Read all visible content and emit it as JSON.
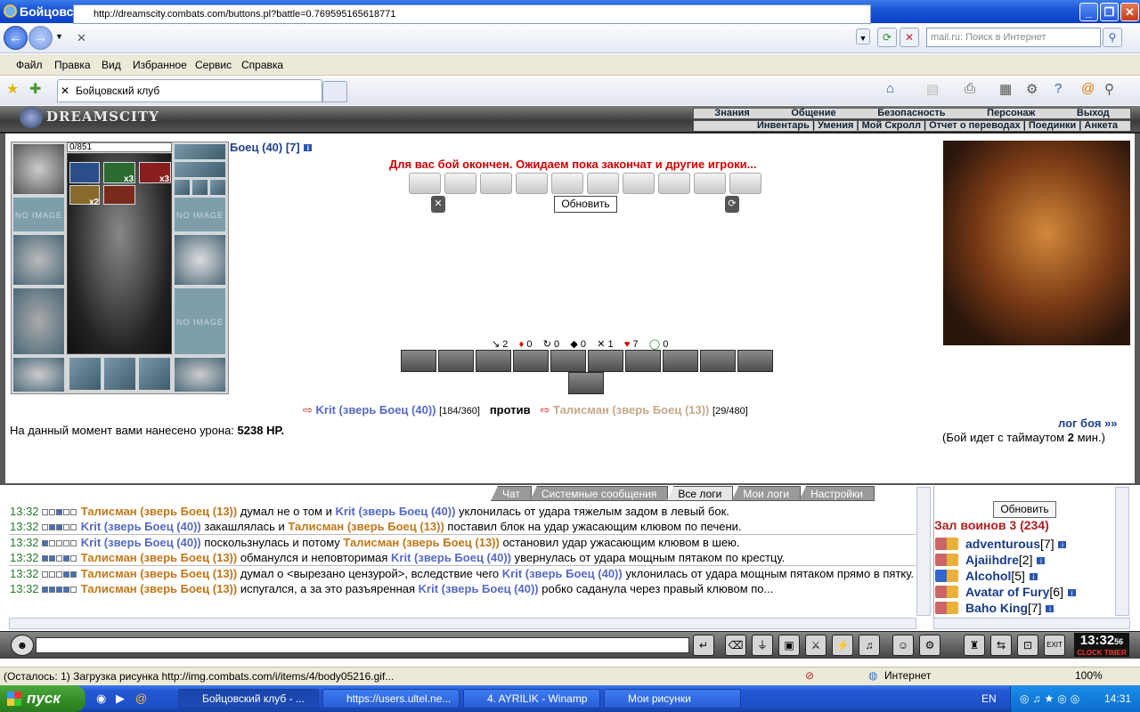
{
  "window": {
    "title": "Бойцовский клуб - Windows Internet Explorer",
    "minimize": "_",
    "maximize": "❐",
    "close": "✕"
  },
  "browser": {
    "address": "http://dreamscity.combats.com/buttons.pl?battle=0.769595165618771",
    "search_placeholder": "mail.ru: Поиск в Интернет",
    "menu": [
      "Файл",
      "Правка",
      "Вид",
      "Избранное",
      "Сервис",
      "Справка"
    ],
    "tab_title": "Бойцовский клуб"
  },
  "game": {
    "logo": "DREAMSCITY",
    "nav_top": [
      "Знания",
      "Общение",
      "Безопасность",
      "Персонаж",
      "Выход"
    ],
    "nav_bottom": "Инвентарь | Умения | Мой Скролл | Отчет о переводах | Поединки | Анкета",
    "hp": "0/851",
    "no_image": "NO IMAGE",
    "fighter_name": "Боец (40) [7]",
    "info_badge": "i",
    "battle_message": "Для вас бой окончен. Ожидаем пока закончат и другие игроки...",
    "refresh_button": "Обновить",
    "stats": [
      {
        "icon": "↘",
        "value": "2"
      },
      {
        "icon": "♦",
        "value": "0"
      },
      {
        "icon": "↻",
        "value": "0"
      },
      {
        "icon": "◆",
        "value": "0"
      },
      {
        "icon": "✕",
        "value": "1"
      },
      {
        "icon": "♥",
        "value": "7"
      },
      {
        "icon": "◯",
        "value": "0"
      }
    ],
    "item_counts": [
      "x3",
      "x3",
      "x2"
    ],
    "vs": {
      "arrow": "⇨",
      "player1": "Krit (зверь Боец (40))",
      "player1_hp": "[184/360]",
      "versus": "против",
      "player2": "Талисман (зверь Боец (13))",
      "player2_hp": "[29/480]"
    },
    "damage_label": "На данный момент вами нанесено урона:",
    "damage_value": "5238 HP.",
    "battle_log": "лог боя »»",
    "timeout_pre": "(Бой идет с таймаутом",
    "timeout_value": "2",
    "timeout_post": "мин.)"
  },
  "chat": {
    "tabs": [
      "Чат",
      "Системные сообщения",
      "Все логи",
      "Мои логи",
      "Настройки"
    ],
    "active_tab": "Все логи",
    "lines": [
      {
        "time": "13:32",
        "boxes": [
          0,
          0,
          1,
          0,
          0
        ],
        "segments": [
          {
            "p": "p1",
            "t": "Талисман (зверь Боец (13))"
          },
          {
            "p": "",
            "t": " думал не о том и "
          },
          {
            "p": "p2",
            "t": "Krit (зверь Боец (40))"
          },
          {
            "p": "",
            "t": " уклонилась от удара тяжелым задом в левый бок."
          }
        ]
      },
      {
        "time": "13:32",
        "boxes": [
          0,
          1,
          1,
          0,
          0
        ],
        "segments": [
          {
            "p": "p2",
            "t": "Krit (зверь Боец (40))"
          },
          {
            "p": "",
            "t": " закашлялась и "
          },
          {
            "p": "p1",
            "t": "Талисман (зверь Боец (13))"
          },
          {
            "p": "",
            "t": " поставил блок на удар ужасающим клювом по печени."
          }
        ]
      },
      {
        "time": "13:32",
        "boxes": [
          1,
          0,
          0,
          0,
          0
        ],
        "segments": [
          {
            "p": "p2",
            "t": "Krit (зверь Боец (40))"
          },
          {
            "p": "",
            "t": " поскользнулась и потому "
          },
          {
            "p": "p1",
            "t": "Талисман (зверь Боец (13))"
          },
          {
            "p": "",
            "t": " остановил удар ужасающим клювом в шею."
          }
        ]
      },
      {
        "time": "13:32",
        "boxes": [
          1,
          1,
          0,
          1,
          0
        ],
        "segments": [
          {
            "p": "p1",
            "t": "Талисман (зверь Боец (13))"
          },
          {
            "p": "",
            "t": " обманулся и неповторимая "
          },
          {
            "p": "p2",
            "t": "Krit (зверь Боец (40))"
          },
          {
            "p": "",
            "t": " увернулась от удара мощным пятаком по крестцу."
          }
        ]
      },
      {
        "time": "13:32",
        "boxes": [
          0,
          0,
          0,
          1,
          1
        ],
        "segments": [
          {
            "p": "p1",
            "t": "Талисман (зверь Боец (13))"
          },
          {
            "p": "",
            "t": " думал о <вырезано цензурой>, вследствие чего "
          },
          {
            "p": "p2",
            "t": "Krit (зверь Боец (40))"
          },
          {
            "p": "",
            "t": " уклонилась от удара мощным пятаком прямо в пятку."
          }
        ]
      },
      {
        "time": "13:32",
        "boxes": [
          1,
          1,
          1,
          1,
          0
        ],
        "segments": [
          {
            "p": "p1",
            "t": "Талисман (зверь Боец (13))"
          },
          {
            "p": "",
            "t": " испугался, а за это разъяренная "
          },
          {
            "p": "p2",
            "t": "Krit (зверь Боец (40))"
          },
          {
            "p": "",
            "t": " робко саданула через правый клювом по..."
          }
        ]
      }
    ]
  },
  "room": {
    "refresh_button": "Обновить",
    "name": "Зал воинов 3 (234)",
    "players": [
      {
        "name": "adventurous",
        "level": "[7]"
      },
      {
        "name": "Ajaiihdre",
        "level": "[2]"
      },
      {
        "name": "Alcohol",
        "level": "[5]"
      },
      {
        "name": "Avatar of Fury",
        "level": "[6]"
      },
      {
        "name": "Baho King",
        "level": "[7]"
      }
    ]
  },
  "clock": {
    "time": "13:32",
    "seconds": "56",
    "label": "CLOCK TIMER"
  },
  "statusbar": {
    "text": "(Осталось: 1) Загрузка рисунка http://img.combats.com/i/items/4/body05216.gif...",
    "zone": "Интернет",
    "zoom": "100%"
  },
  "taskbar": {
    "start": "пуск",
    "tasks": [
      "Бойцовский клуб - ...",
      "https://users.ultel.ne...",
      "4. AYRILIK - Winamp",
      "Мои рисунки"
    ],
    "lang": "EN",
    "time": "14:31"
  }
}
